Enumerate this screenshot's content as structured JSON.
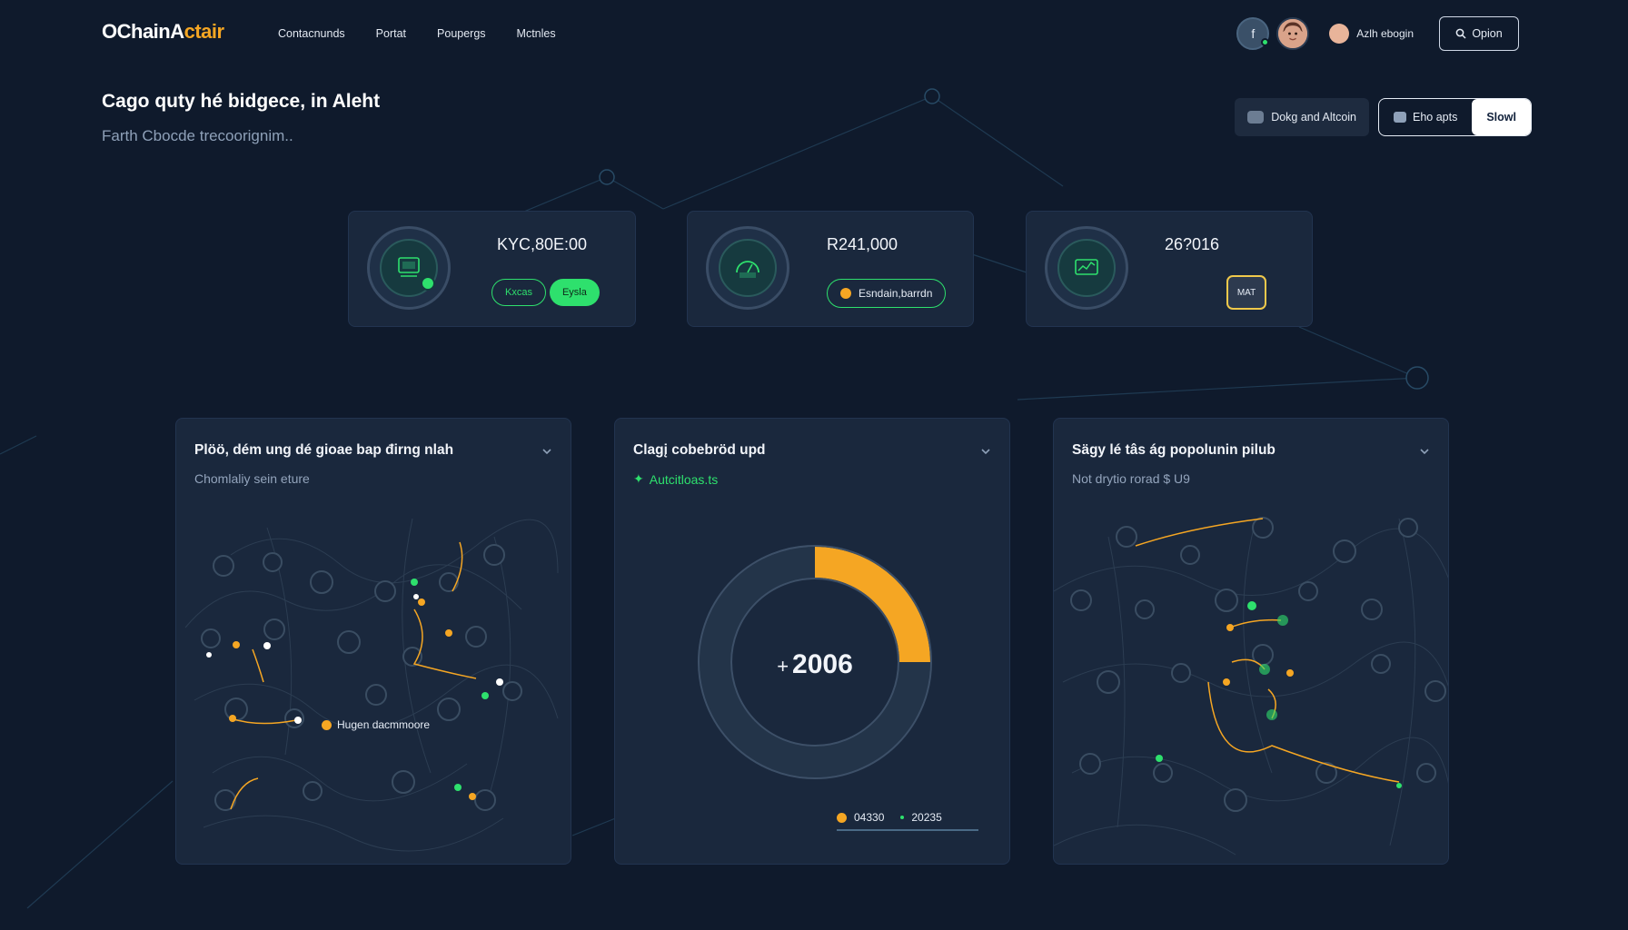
{
  "app": {
    "logo_main": "OChainA",
    "logo_accent": "ctair"
  },
  "nav": {
    "items": [
      {
        "label": "Contacnunds"
      },
      {
        "label": "Portat"
      },
      {
        "label": "Poupergs"
      },
      {
        "label": "Mctnles"
      }
    ]
  },
  "user": {
    "avatar_initial": "f",
    "name": "Azlh ebogin",
    "option_label": "Opion"
  },
  "header": {
    "title": "Cago quty hé bidgece, in Aleht",
    "subtitle": "Farth Cbocde trecoorignim..",
    "action_label": "Dokg and Altcoin",
    "segment_options": [
      {
        "label": "Eho apts",
        "active": false
      },
      {
        "label": "Slowl",
        "active": true
      }
    ]
  },
  "stats": [
    {
      "value": "KYC,80E:00",
      "tag_outline": "Kxcas",
      "tag_solid": "Eysla"
    },
    {
      "value": "R241,000",
      "status": "Esndain,barrdn"
    },
    {
      "value": "26?016",
      "tag": "MAT"
    }
  ],
  "panels": [
    {
      "title": "Plöö, dém ung dé gioae bap đirng nlah",
      "subtitle": "Chomlaliy sein eture",
      "map_label": "Hugen dacmmoore"
    },
    {
      "title": "Clagį cobebröd upd",
      "subtitle": "Autcitloas.ts",
      "center_value": "2006",
      "center_prefix": "+",
      "legend": [
        {
          "label": "04330"
        },
        {
          "label": "20235"
        }
      ]
    },
    {
      "title": "Sägy lé tâs ág popolunin pilub",
      "subtitle": "Not drytio rorad $ U9"
    }
  ],
  "chart_data": {
    "type": "pie",
    "values": [
      25,
      75
    ],
    "categories": [
      "04330",
      "20235"
    ],
    "colors": [
      "#f5a623",
      "#233449"
    ]
  },
  "colors": {
    "background": "#0f1a2c",
    "card": "#1a283d",
    "accent_green": "#2ee06d",
    "accent_orange": "#f5a623",
    "accent_yellow": "#f0c94b"
  }
}
